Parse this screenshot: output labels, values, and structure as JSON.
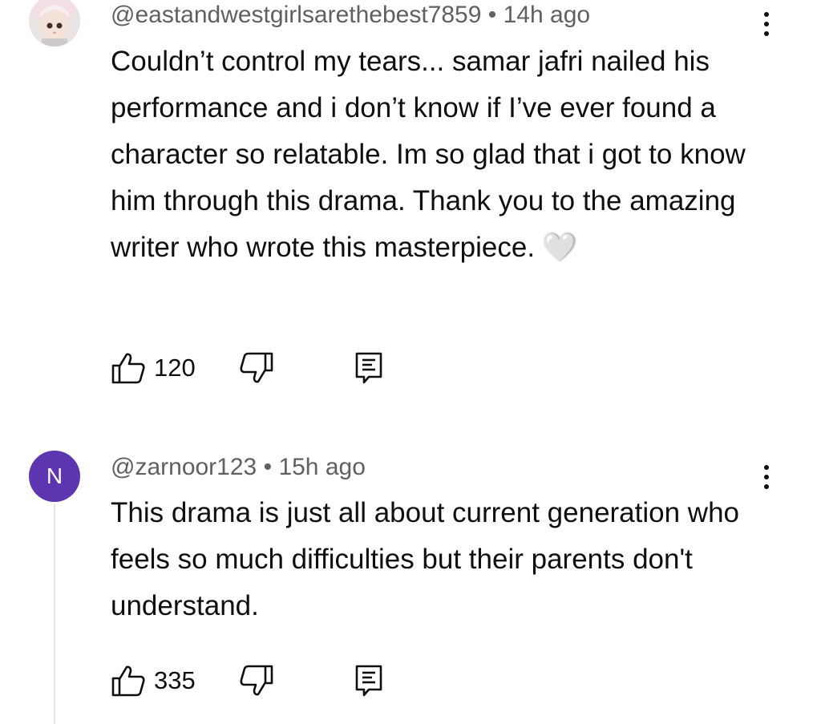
{
  "comments": [
    {
      "handle": "@eastandwestgirlsarethebest7859",
      "time": "14h ago",
      "text": "Couldn’t control my tears... samar jafri nailed his performance and i don’t know if I’ve ever found a character so relatable. Im so glad that i got to know him through this drama. Thank you to the amazing writer who wrote this masterpiece.",
      "emoji": "🤍",
      "likes": "120",
      "avatar": "doll-avatar-image"
    },
    {
      "handle": "@zarnoor123",
      "time": "15h ago",
      "text": "This drama is just all about current generation who feels so much difficulties but their parents don't understand.",
      "likes": "335",
      "avatar_letter": "N",
      "avatar_color": "#5e35b1"
    }
  ],
  "separator": "•",
  "icons": [
    "thumbs-up-icon",
    "thumbs-down-icon",
    "reply-icon",
    "more-vertical-icon"
  ]
}
